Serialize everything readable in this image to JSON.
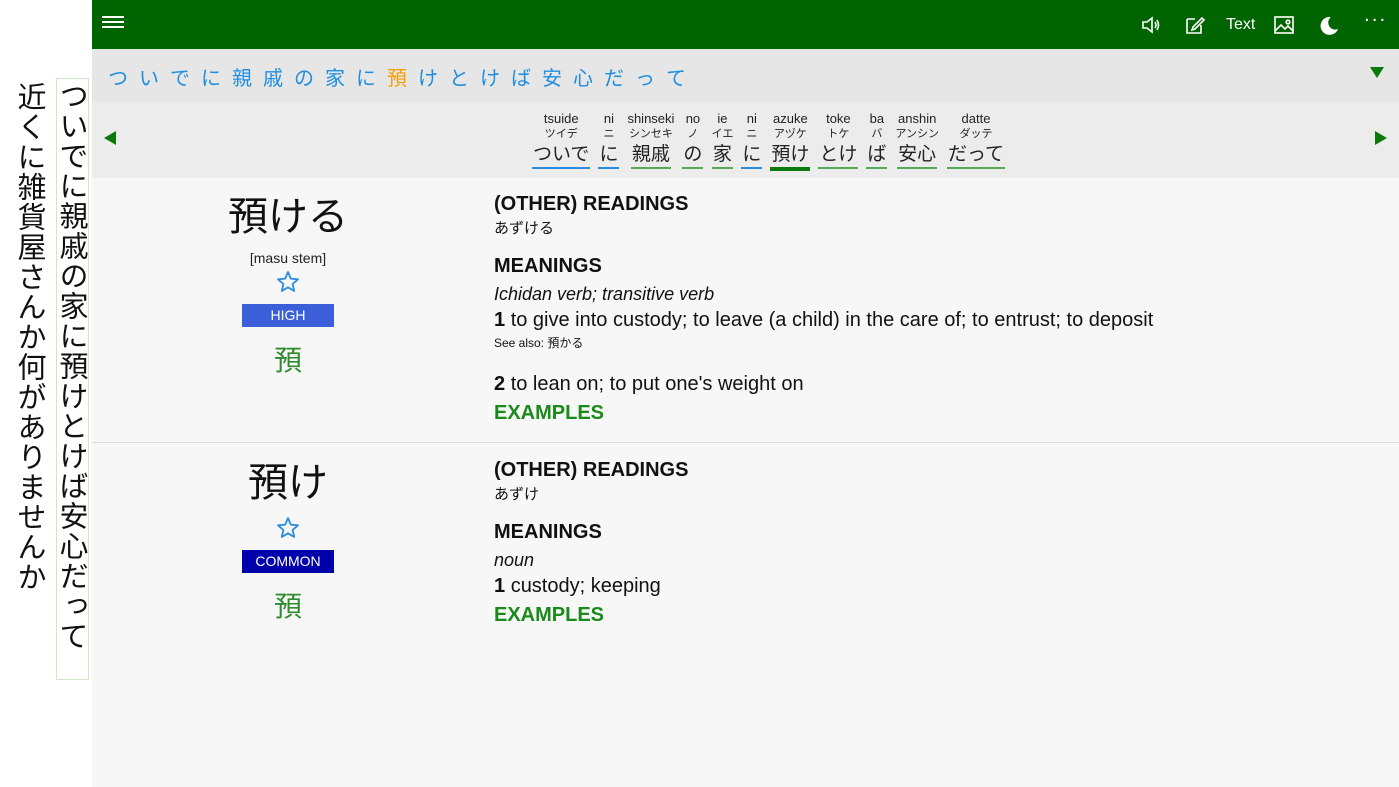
{
  "vertical_text": {
    "column_1": "ついでに親戚の家に預けとけば安心だって",
    "column_2": "近くに雑貨屋さんか何がありませんか"
  },
  "toolbar": {
    "menu_icon": "hamburger-icon",
    "speaker_icon": "speaker-icon",
    "edit_icon": "edit-icon",
    "text_label": "Text",
    "image_icon": "image-icon",
    "moon_icon": "moon-icon",
    "more_label": "···"
  },
  "sentence": {
    "chars": [
      "つ",
      "い",
      "で",
      "に",
      "親",
      "戚",
      "の",
      "家",
      "に",
      "預",
      "け",
      "と",
      "け",
      "ば",
      "安",
      "心",
      "だ",
      "っ",
      "て"
    ],
    "highlight_index": 9
  },
  "tokens": [
    {
      "romaji": "tsuide",
      "kana": "ツイデ",
      "surface": "ついで"
    },
    {
      "romaji": "ni",
      "kana": "ニ",
      "surface": "に"
    },
    {
      "romaji": "shinseki",
      "kana": "シンセキ",
      "surface": "親戚"
    },
    {
      "romaji": "no",
      "kana": "ノ",
      "surface": "の"
    },
    {
      "romaji": "ie",
      "kana": "イエ",
      "surface": "家"
    },
    {
      "romaji": "ni",
      "kana": "ニ",
      "surface": "に"
    },
    {
      "romaji": "azuke",
      "kana": "アヅケ",
      "surface": "預け"
    },
    {
      "romaji": "toke",
      "kana": "トケ",
      "surface": "とけ"
    },
    {
      "romaji": "ba",
      "kana": "バ",
      "surface": "ば"
    },
    {
      "romaji": "anshin",
      "kana": "アンシン",
      "surface": "安心"
    },
    {
      "romaji": "datte",
      "kana": "ダッテ",
      "surface": "だって"
    }
  ],
  "entries": [
    {
      "headword": "預ける",
      "stem": "[masu stem]",
      "badge": "HIGH",
      "kanji": "預",
      "readings_title": "(OTHER) READINGS",
      "reading": "あずける",
      "meanings_title": "MEANINGS",
      "pos": "Ichidan verb; transitive verb",
      "senses": [
        {
          "num": "1",
          "text": "to give into custody; to leave (a child) in the care of; to entrust; to deposit",
          "see_also": "See also: 預かる"
        },
        {
          "num": "2",
          "text": "to lean on; to put one's weight on"
        }
      ],
      "examples": "EXAMPLES"
    },
    {
      "headword": "預け",
      "badge": "COMMON",
      "kanji": "預",
      "readings_title": "(OTHER) READINGS",
      "reading": "あずけ",
      "meanings_title": "MEANINGS",
      "pos": "noun",
      "senses": [
        {
          "num": "1",
          "text": "custody; keeping"
        }
      ],
      "examples": "EXAMPLES"
    }
  ],
  "colors": {
    "topbar": "#006400",
    "sentence_text": "#1f8ee0",
    "sentence_highlight": "#f5a000",
    "link_green": "#1a8a1a",
    "badge_high": "#3a5fd8",
    "badge_common": "#0000aa"
  }
}
